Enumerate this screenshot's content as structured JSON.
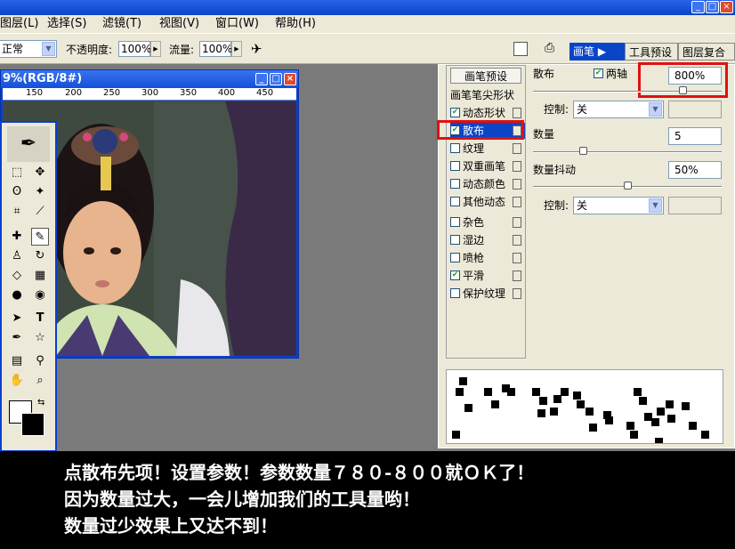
{
  "menubar": {
    "items": [
      "图层(L)",
      "选择(S)",
      "滤镜(T)",
      "视图(V)",
      "窗口(W)",
      "帮助(H)"
    ]
  },
  "options": {
    "mode_value": "正常",
    "opacity_label": "不透明度:",
    "opacity_value": "100%",
    "flow_label": "流量:",
    "flow_value": "100%"
  },
  "tabs": [
    "画笔",
    "工具预设",
    "图层复合"
  ],
  "document": {
    "title": "9%(RGB/8#)",
    "ruler_ticks": [
      "150",
      "200",
      "250",
      "300",
      "350",
      "400",
      "450"
    ]
  },
  "brushes": {
    "presets_button": "画笔预设",
    "tip_shape": "画笔笔尖形状",
    "options": [
      {
        "label": "动态形状",
        "checked": true
      },
      {
        "label": "散布",
        "checked": true
      },
      {
        "label": "纹理",
        "checked": false
      },
      {
        "label": "双重画笔",
        "checked": false
      },
      {
        "label": "动态颜色",
        "checked": false
      },
      {
        "label": "其他动态",
        "checked": false
      },
      {
        "label": "杂色",
        "checked": false
      },
      {
        "label": "湿边",
        "checked": false
      },
      {
        "label": "喷枪",
        "checked": false
      },
      {
        "label": "平滑",
        "checked": true
      },
      {
        "label": "保护纹理",
        "checked": false
      }
    ],
    "scatter_label": "散布",
    "both_axes_label": "两轴",
    "both_axes_checked": true,
    "scatter_value": "800%",
    "control_label": "控制:",
    "control_value": "关",
    "count_label": "数量",
    "count_value": "5",
    "count_jitter_label": "数量抖动",
    "count_jitter_value": "50%",
    "control2_label": "控制:",
    "control2_value": "关"
  },
  "caption": {
    "line1": "点散布先项！设置参数！参数数量７８０-８００就ＯＫ了！",
    "line2": "因为数量过大，一会儿增加我们的工具量哟！",
    "line3": "数量过少效果上又达不到！"
  },
  "colors": {
    "highlight": "#e01010",
    "title_blue": "#0a45c8"
  }
}
